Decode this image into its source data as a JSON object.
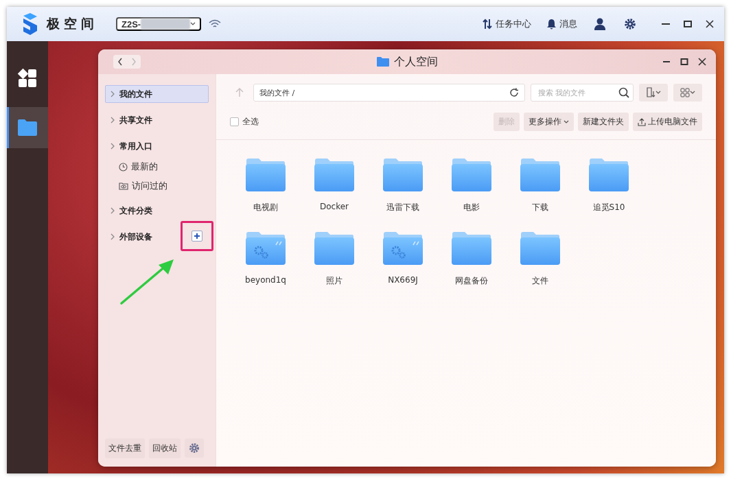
{
  "app": {
    "name": "极空间",
    "device": "Z2S-",
    "task_center": "任务中心",
    "messages": "消息"
  },
  "dock": [
    {
      "kind": "apps",
      "selected": false
    },
    {
      "kind": "files",
      "selected": true
    }
  ],
  "window": {
    "title": "个人空间"
  },
  "sidebar": {
    "items": [
      {
        "label": "我的文件",
        "selected": true
      },
      {
        "label": "共享文件",
        "selected": false
      },
      {
        "label": "常用入口",
        "selected": false,
        "children": [
          {
            "label": "最新的",
            "kind": "clock",
            "selected": false
          },
          {
            "label": "访问过的",
            "kind": "eye",
            "selected": false
          }
        ]
      },
      {
        "label": "文件分类",
        "selected": false
      },
      {
        "label": "外部设备",
        "selected": false,
        "add": true
      }
    ],
    "bottom_buttons": [
      "文件去重",
      "回收站"
    ]
  },
  "path": "我的文件 /",
  "search": {
    "placeholder": "搜索 我的文件"
  },
  "toolbar": {
    "select_all": {
      "label": "全选",
      "checked": false
    },
    "buttons": [
      {
        "label": "删除",
        "disabled": true,
        "dropdown": false,
        "upload": false
      },
      {
        "label": "更多操作",
        "disabled": false,
        "dropdown": true,
        "upload": false
      },
      {
        "label": "新建文件夹",
        "disabled": false,
        "dropdown": false,
        "upload": false
      },
      {
        "label": "上传电脑文件",
        "disabled": false,
        "dropdown": false,
        "upload": true
      }
    ]
  },
  "folders": [
    {
      "name": "电视剧",
      "kind": "plain"
    },
    {
      "name": "Docker",
      "kind": "plain"
    },
    {
      "name": "迅雷下载",
      "kind": "plain"
    },
    {
      "name": "电影",
      "kind": "plain"
    },
    {
      "name": "下载",
      "kind": "plain"
    },
    {
      "name": "追觅S10",
      "kind": "plain"
    },
    {
      "name": "beyond1q",
      "kind": "device"
    },
    {
      "name": "照片",
      "kind": "plain"
    },
    {
      "name": "NX669J",
      "kind": "device"
    },
    {
      "name": "网盘备份",
      "kind": "plain"
    },
    {
      "name": "文件",
      "kind": "plain"
    }
  ]
}
